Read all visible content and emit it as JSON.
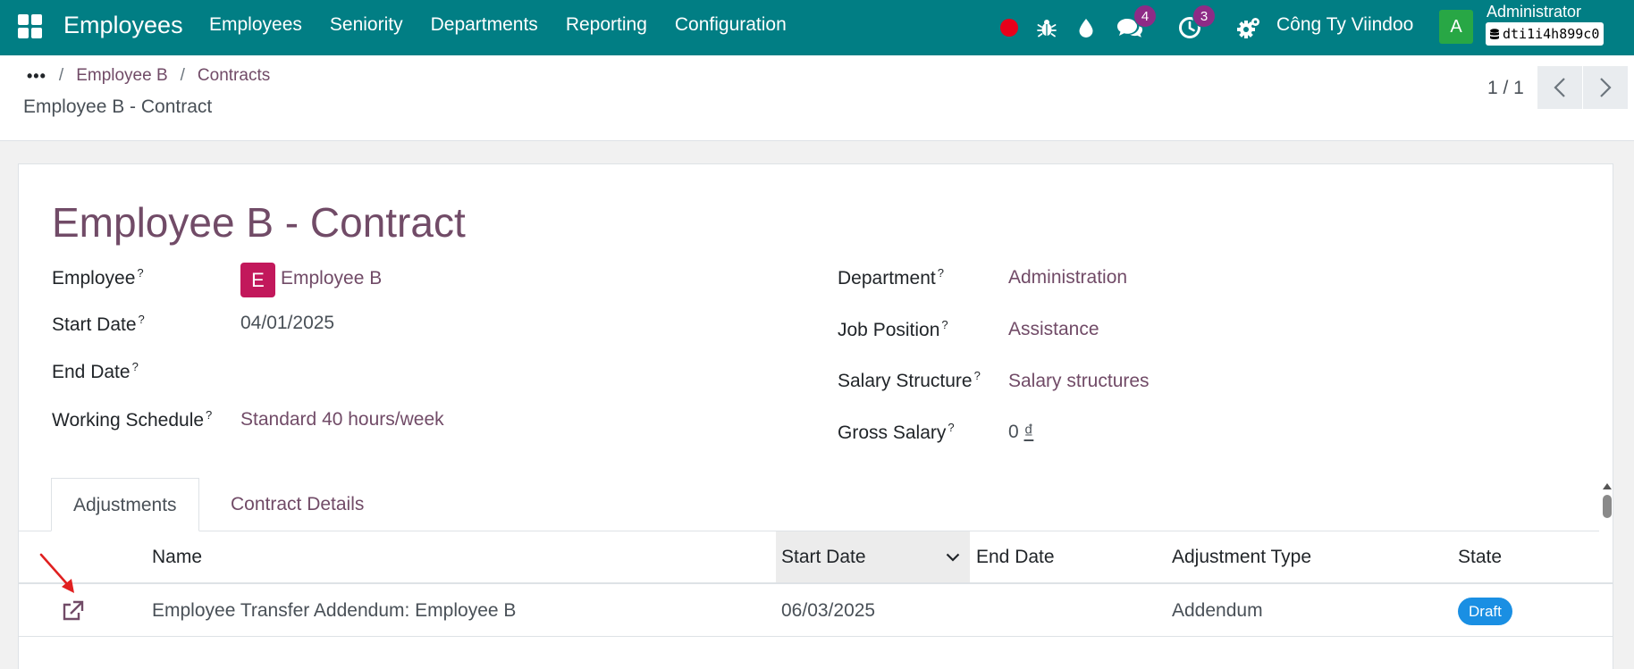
{
  "navbar": {
    "app_title": "Employees",
    "menu": [
      "Employees",
      "Seniority",
      "Departments",
      "Reporting",
      "Configuration"
    ],
    "icons": [
      "apps-grid-icon",
      "record-icon",
      "bug-icon",
      "droplet-icon",
      "chat-icon",
      "activity-clock-icon",
      "settings-icon"
    ],
    "messages_count": "4",
    "activities_count": "3",
    "company": "Công Ty Viindoo",
    "user_initial": "A",
    "user_name": "Administrator",
    "database": "dti1i4h899c0",
    "record_color": "#e8001a",
    "bar_color": "#017e84"
  },
  "control_panel": {
    "breadcrumb": {
      "overflow": "•••",
      "items": [
        "Employee B",
        "Contracts"
      ],
      "current": "Employee B - Contract"
    },
    "pager": "1 / 1"
  },
  "form": {
    "title": "Employee B - Contract",
    "help_mark": "?",
    "left": {
      "employee": {
        "label": "Employee",
        "avatar": "E",
        "value": "Employee B"
      },
      "start_date": {
        "label": "Start Date",
        "value": "04/01/2025"
      },
      "end_date": {
        "label": "End Date",
        "value": ""
      },
      "working_schedule": {
        "label": "Working Schedule",
        "value": "Standard 40 hours/week"
      }
    },
    "right": {
      "department": {
        "label": "Department",
        "value": "Administration"
      },
      "job_position": {
        "label": "Job Position",
        "value": "Assistance"
      },
      "salary_structure": {
        "label": "Salary Structure",
        "value": "Salary structures"
      },
      "gross_salary": {
        "label": "Gross Salary",
        "amount": "0",
        "currency": "₫"
      }
    },
    "tabs": [
      "Adjustments",
      "Contract Details"
    ],
    "accent_color": "#714b67"
  },
  "adjustments": {
    "columns": [
      "Name",
      "Start Date",
      "End Date",
      "Adjustment Type",
      "State"
    ],
    "rows": [
      {
        "name": "Employee Transfer Addendum: Employee B",
        "start_date": "06/03/2025",
        "end_date": "",
        "type": "Addendum",
        "state": "Draft"
      }
    ],
    "state_color": "#1a8fe3",
    "annotation_color": "#e02020"
  }
}
